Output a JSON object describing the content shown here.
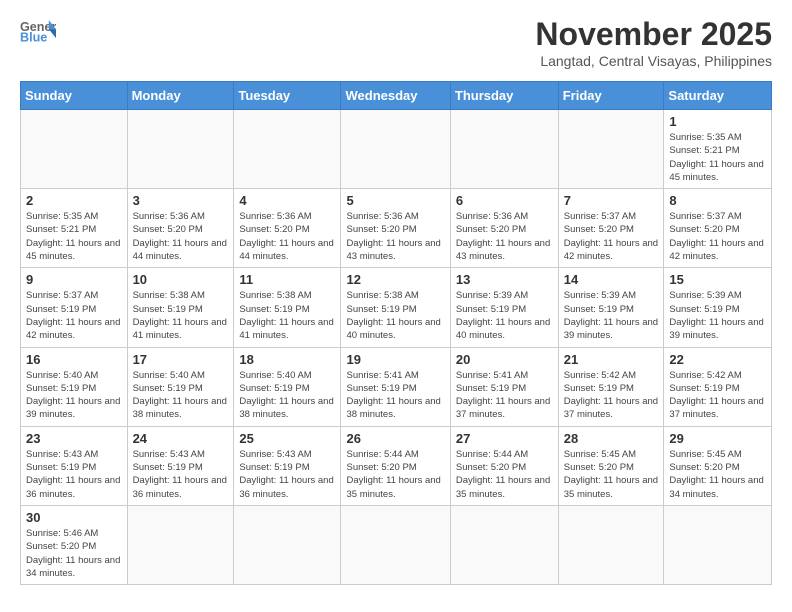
{
  "header": {
    "logo_general": "General",
    "logo_blue": "Blue",
    "title": "November 2025",
    "subtitle": "Langtad, Central Visayas, Philippines"
  },
  "weekdays": [
    "Sunday",
    "Monday",
    "Tuesday",
    "Wednesday",
    "Thursday",
    "Friday",
    "Saturday"
  ],
  "weeks": [
    [
      {
        "day": "",
        "info": ""
      },
      {
        "day": "",
        "info": ""
      },
      {
        "day": "",
        "info": ""
      },
      {
        "day": "",
        "info": ""
      },
      {
        "day": "",
        "info": ""
      },
      {
        "day": "",
        "info": ""
      },
      {
        "day": "1",
        "info": "Sunrise: 5:35 AM\nSunset: 5:21 PM\nDaylight: 11 hours and 45 minutes."
      }
    ],
    [
      {
        "day": "2",
        "info": "Sunrise: 5:35 AM\nSunset: 5:21 PM\nDaylight: 11 hours and 45 minutes."
      },
      {
        "day": "3",
        "info": "Sunrise: 5:36 AM\nSunset: 5:20 PM\nDaylight: 11 hours and 44 minutes."
      },
      {
        "day": "4",
        "info": "Sunrise: 5:36 AM\nSunset: 5:20 PM\nDaylight: 11 hours and 44 minutes."
      },
      {
        "day": "5",
        "info": "Sunrise: 5:36 AM\nSunset: 5:20 PM\nDaylight: 11 hours and 43 minutes."
      },
      {
        "day": "6",
        "info": "Sunrise: 5:36 AM\nSunset: 5:20 PM\nDaylight: 11 hours and 43 minutes."
      },
      {
        "day": "7",
        "info": "Sunrise: 5:37 AM\nSunset: 5:20 PM\nDaylight: 11 hours and 42 minutes."
      },
      {
        "day": "8",
        "info": "Sunrise: 5:37 AM\nSunset: 5:20 PM\nDaylight: 11 hours and 42 minutes."
      }
    ],
    [
      {
        "day": "9",
        "info": "Sunrise: 5:37 AM\nSunset: 5:19 PM\nDaylight: 11 hours and 42 minutes."
      },
      {
        "day": "10",
        "info": "Sunrise: 5:38 AM\nSunset: 5:19 PM\nDaylight: 11 hours and 41 minutes."
      },
      {
        "day": "11",
        "info": "Sunrise: 5:38 AM\nSunset: 5:19 PM\nDaylight: 11 hours and 41 minutes."
      },
      {
        "day": "12",
        "info": "Sunrise: 5:38 AM\nSunset: 5:19 PM\nDaylight: 11 hours and 40 minutes."
      },
      {
        "day": "13",
        "info": "Sunrise: 5:39 AM\nSunset: 5:19 PM\nDaylight: 11 hours and 40 minutes."
      },
      {
        "day": "14",
        "info": "Sunrise: 5:39 AM\nSunset: 5:19 PM\nDaylight: 11 hours and 39 minutes."
      },
      {
        "day": "15",
        "info": "Sunrise: 5:39 AM\nSunset: 5:19 PM\nDaylight: 11 hours and 39 minutes."
      }
    ],
    [
      {
        "day": "16",
        "info": "Sunrise: 5:40 AM\nSunset: 5:19 PM\nDaylight: 11 hours and 39 minutes."
      },
      {
        "day": "17",
        "info": "Sunrise: 5:40 AM\nSunset: 5:19 PM\nDaylight: 11 hours and 38 minutes."
      },
      {
        "day": "18",
        "info": "Sunrise: 5:40 AM\nSunset: 5:19 PM\nDaylight: 11 hours and 38 minutes."
      },
      {
        "day": "19",
        "info": "Sunrise: 5:41 AM\nSunset: 5:19 PM\nDaylight: 11 hours and 38 minutes."
      },
      {
        "day": "20",
        "info": "Sunrise: 5:41 AM\nSunset: 5:19 PM\nDaylight: 11 hours and 37 minutes."
      },
      {
        "day": "21",
        "info": "Sunrise: 5:42 AM\nSunset: 5:19 PM\nDaylight: 11 hours and 37 minutes."
      },
      {
        "day": "22",
        "info": "Sunrise: 5:42 AM\nSunset: 5:19 PM\nDaylight: 11 hours and 37 minutes."
      }
    ],
    [
      {
        "day": "23",
        "info": "Sunrise: 5:43 AM\nSunset: 5:19 PM\nDaylight: 11 hours and 36 minutes."
      },
      {
        "day": "24",
        "info": "Sunrise: 5:43 AM\nSunset: 5:19 PM\nDaylight: 11 hours and 36 minutes."
      },
      {
        "day": "25",
        "info": "Sunrise: 5:43 AM\nSunset: 5:19 PM\nDaylight: 11 hours and 36 minutes."
      },
      {
        "day": "26",
        "info": "Sunrise: 5:44 AM\nSunset: 5:20 PM\nDaylight: 11 hours and 35 minutes."
      },
      {
        "day": "27",
        "info": "Sunrise: 5:44 AM\nSunset: 5:20 PM\nDaylight: 11 hours and 35 minutes."
      },
      {
        "day": "28",
        "info": "Sunrise: 5:45 AM\nSunset: 5:20 PM\nDaylight: 11 hours and 35 minutes."
      },
      {
        "day": "29",
        "info": "Sunrise: 5:45 AM\nSunset: 5:20 PM\nDaylight: 11 hours and 34 minutes."
      }
    ],
    [
      {
        "day": "30",
        "info": "Sunrise: 5:46 AM\nSunset: 5:20 PM\nDaylight: 11 hours and 34 minutes."
      },
      {
        "day": "",
        "info": ""
      },
      {
        "day": "",
        "info": ""
      },
      {
        "day": "",
        "info": ""
      },
      {
        "day": "",
        "info": ""
      },
      {
        "day": "",
        "info": ""
      },
      {
        "day": "",
        "info": ""
      }
    ]
  ]
}
